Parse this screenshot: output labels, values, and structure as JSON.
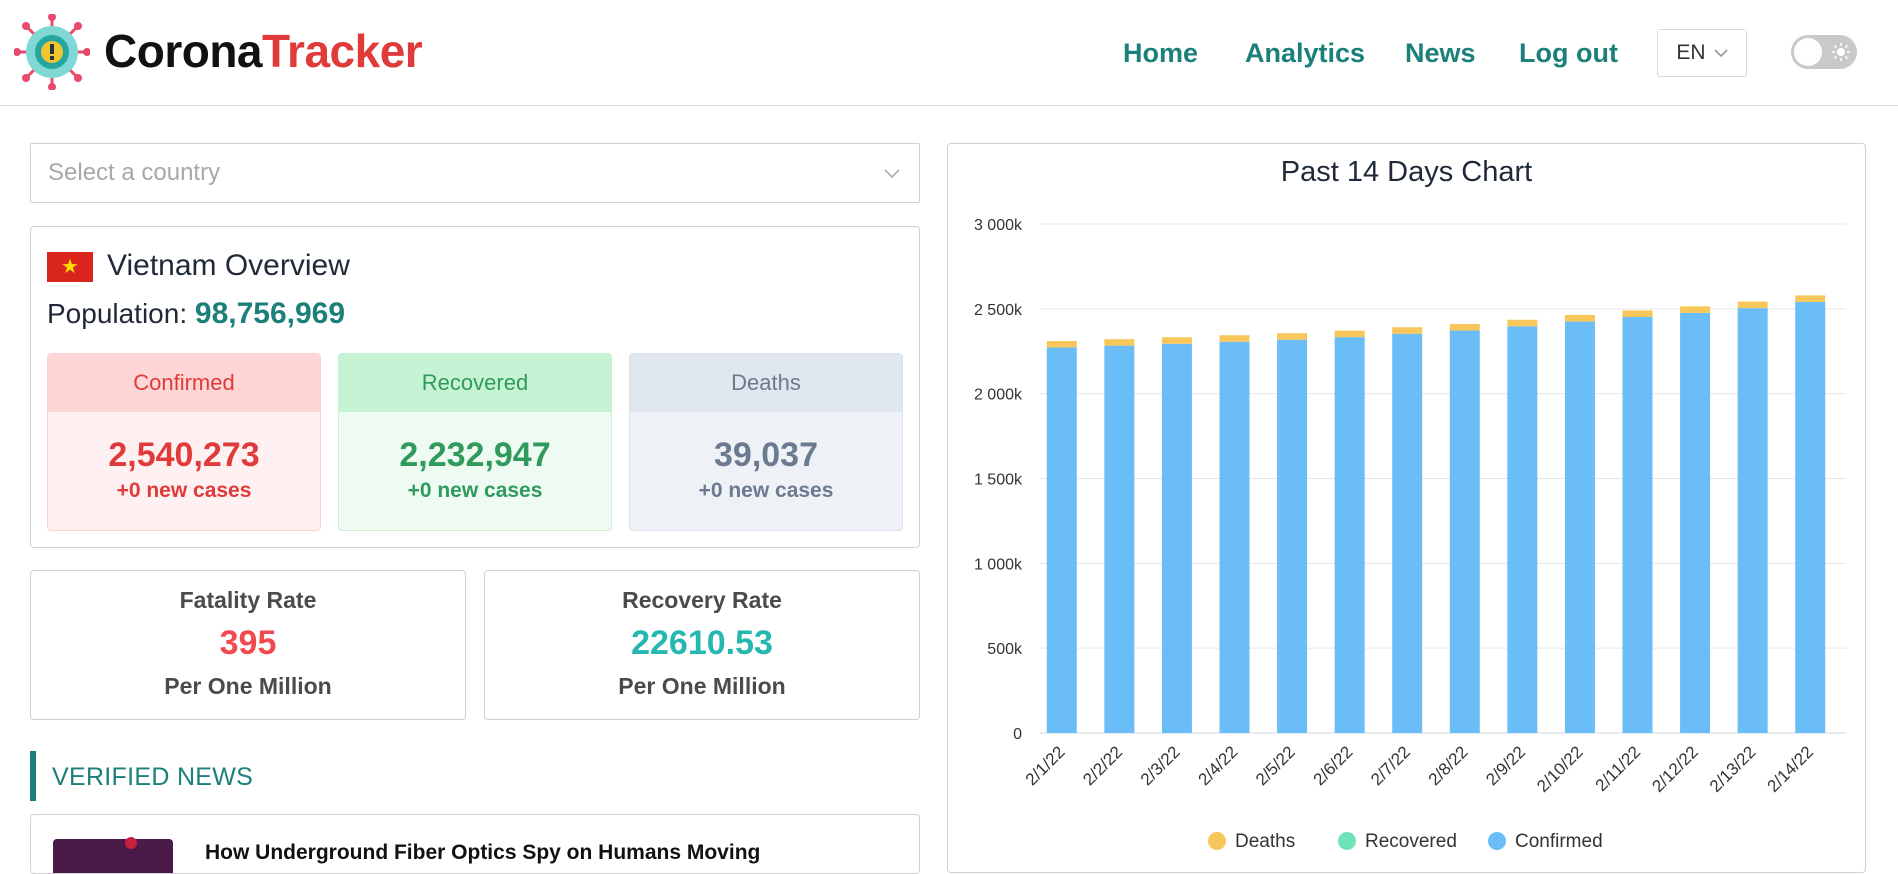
{
  "header": {
    "brand_part1": "Corona",
    "brand_part2": "Tracker",
    "nav": [
      "Home",
      "Analytics",
      "News",
      "Log out"
    ],
    "language": "EN"
  },
  "country_select": {
    "placeholder": "Select a country"
  },
  "overview": {
    "title": "Vietnam Overview",
    "population_label": "Population:",
    "population_value": "98,756,969",
    "confirmed": {
      "label": "Confirmed",
      "value": "2,540,273",
      "new": "+0 new cases"
    },
    "recovered": {
      "label": "Recovered",
      "value": "2,232,947",
      "new": "+0 new cases"
    },
    "deaths": {
      "label": "Deaths",
      "value": "39,037",
      "new": "+0 new cases"
    }
  },
  "rates": {
    "fatality": {
      "label": "Fatality Rate",
      "value": "395",
      "unit": "Per One Million",
      "color": "#f0494f"
    },
    "recovery": {
      "label": "Recovery Rate",
      "value": "22610.53",
      "unit": "Per One Million",
      "color": "#25b8b0"
    }
  },
  "news": {
    "section_title": "VERIFIED NEWS",
    "first_headline": "How Underground Fiber Optics Spy on Humans Moving"
  },
  "colors": {
    "accent": "#1b7f7a",
    "brand_red": "#e03a3a",
    "confirmed_bar": "#6bbdf8",
    "deaths_bar": "#f7c75c",
    "recovered_legend": "#6fe3b8"
  },
  "chart_data": {
    "type": "bar",
    "stacked": true,
    "title": "Past 14 Days Chart",
    "categories": [
      "2/1/22",
      "2/2/22",
      "2/3/22",
      "2/4/22",
      "2/5/22",
      "2/6/22",
      "2/7/22",
      "2/8/22",
      "2/9/22",
      "2/10/22",
      "2/11/22",
      "2/12/22",
      "2/13/22",
      "2/14/22"
    ],
    "series": [
      {
        "name": "Confirmed",
        "color": "#6bbdf8",
        "values": [
          2272000,
          2283000,
          2294000,
          2306000,
          2318000,
          2333000,
          2353000,
          2372000,
          2397000,
          2425000,
          2452000,
          2476000,
          2504000,
          2540273
        ]
      },
      {
        "name": "Deaths",
        "color": "#f7c75c",
        "values": [
          38300,
          38400,
          38450,
          38500,
          38550,
          38600,
          38650,
          38700,
          38760,
          38820,
          38880,
          38940,
          38990,
          39037
        ]
      }
    ],
    "legend": [
      {
        "name": "Deaths",
        "color": "#f7c75c"
      },
      {
        "name": "Recovered",
        "color": "#6fe3b8"
      },
      {
        "name": "Confirmed",
        "color": "#6bbdf8"
      }
    ],
    "yticks": [
      "0",
      "500k",
      "1 000k",
      "1 500k",
      "2 000k",
      "2 500k",
      "3 000k"
    ],
    "ylim": [
      0,
      3000000
    ],
    "grid": true,
    "legend_position": "bottom"
  }
}
